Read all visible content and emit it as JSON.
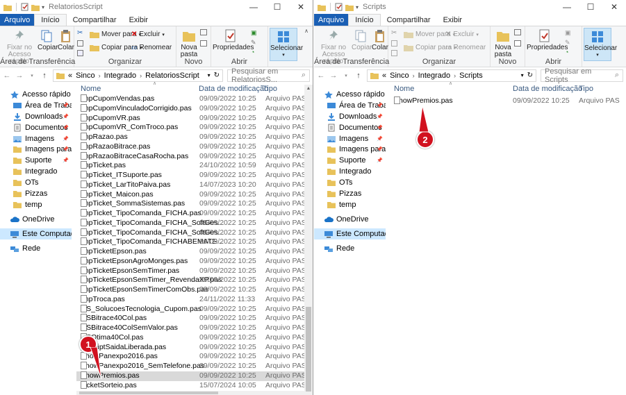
{
  "left": {
    "title": "RelatoriosScript",
    "tabs": [
      "Arquivo",
      "Início",
      "Compartilhar",
      "Exibir"
    ],
    "ribbon": {
      "pin": "Fixar no Acesso rápido",
      "copy": "Copiar",
      "paste": "Colar",
      "move": "Mover para",
      "copyto": "Copiar para",
      "delete": "Excluir",
      "rename": "Renomear",
      "newfolder": "Nova pasta",
      "properties": "Propriedades",
      "select": "Selecionar",
      "g_clip": "Área de Transferência",
      "g_org": "Organizar",
      "g_new": "Novo",
      "g_open": "Abrir"
    },
    "path": [
      "Sinco",
      "Integrado",
      "RelatoriosScript"
    ],
    "path_prefix": "«",
    "search_placeholder": "Pesquisar em RelatoriosS...",
    "columns": {
      "name": "Nome",
      "date": "Data de modificação",
      "type": "Tipo"
    },
    "files": [
      {
        "name": "ImpCupomVendas.pas",
        "date": "09/09/2022 10:25",
        "type": "Arquivo PAS"
      },
      {
        "name": "ImpCupomVinculadoCorrigido.pas",
        "date": "09/09/2022 10:25",
        "type": "Arquivo PAS"
      },
      {
        "name": "ImpCupomVR.pas",
        "date": "09/09/2022 10:25",
        "type": "Arquivo PAS"
      },
      {
        "name": "ImpCupomVR_ComTroco.pas",
        "date": "09/09/2022 10:25",
        "type": "Arquivo PAS"
      },
      {
        "name": "ImpRazao.pas",
        "date": "09/09/2022 10:25",
        "type": "Arquivo PAS"
      },
      {
        "name": "ImpRazaoBitrace.pas",
        "date": "09/09/2022 10:25",
        "type": "Arquivo PAS"
      },
      {
        "name": "ImpRazaoBitraceCasaRocha.pas",
        "date": "09/09/2022 10:25",
        "type": "Arquivo PAS"
      },
      {
        "name": "ImpTicket.pas",
        "date": "24/10/2022 10:59",
        "type": "Arquivo PAS"
      },
      {
        "name": "ImpTicket_ITSuporte.pas",
        "date": "09/09/2022 10:25",
        "type": "Arquivo PAS"
      },
      {
        "name": "ImpTicket_LarTitoPaiva.pas",
        "date": "14/07/2023 10:20",
        "type": "Arquivo PAS"
      },
      {
        "name": "ImpTicket_Maicon.pas",
        "date": "09/09/2022 10:25",
        "type": "Arquivo PAS"
      },
      {
        "name": "ImpTicket_SommaSistemas.pas",
        "date": "09/09/2022 10:25",
        "type": "Arquivo PAS"
      },
      {
        "name": "ImpTicket_TipoComanda_FICHA.pas",
        "date": "09/09/2022 10:25",
        "type": "Arquivo PAS"
      },
      {
        "name": "ImpTicket_TipoComanda_FICHA_SoftGes...",
        "date": "09/09/2022 10:25",
        "type": "Arquivo PAS"
      },
      {
        "name": "ImpTicket_TipoComanda_FICHA_SoftGes...",
        "date": "09/09/2022 10:25",
        "type": "Arquivo PAS"
      },
      {
        "name": "ImpTicket_TipoComanda_FICHABEMATE...",
        "date": "09/09/2022 10:25",
        "type": "Arquivo PAS"
      },
      {
        "name": "ImpTicketEpson.pas",
        "date": "09/09/2022 10:25",
        "type": "Arquivo PAS"
      },
      {
        "name": "ImpTicketEpsonAgroMonges.pas",
        "date": "09/09/2022 10:25",
        "type": "Arquivo PAS"
      },
      {
        "name": "ImpTicketEpsonSemTimer.pas",
        "date": "09/09/2022 10:25",
        "type": "Arquivo PAS"
      },
      {
        "name": "ImpTicketEpsonSemTimer_RevendaXP.pas",
        "date": "09/09/2022 10:25",
        "type": "Arquivo PAS"
      },
      {
        "name": "ImpTicketEpsonSemTimerComObs.pas",
        "date": "09/09/2022 10:25",
        "type": "Arquivo PAS"
      },
      {
        "name": "ImpTroca.pas",
        "date": "24/11/2022 11:33",
        "type": "Arquivo PAS"
      },
      {
        "name": "OS_SolucoesTecnologia_Cupom.pas",
        "date": "09/09/2022 10:25",
        "type": "Arquivo PAS"
      },
      {
        "name": "OSBitrace40Col.pas",
        "date": "09/09/2022 10:25",
        "type": "Arquivo PAS"
      },
      {
        "name": "OSBitrace40ColSemValor.pas",
        "date": "09/09/2022 10:25",
        "type": "Arquivo PAS"
      },
      {
        "name": "OSOtima40Col.pas",
        "date": "09/09/2022 10:25",
        "type": "Arquivo PAS"
      },
      {
        "name": "ReceiptSaidaLiberada.pas",
        "date": "09/09/2022 10:25",
        "type": "Arquivo PAS"
      },
      {
        "name": "ShowPanexpo2016.pas",
        "date": "09/09/2022 10:25",
        "type": "Arquivo PAS"
      },
      {
        "name": "ShowPanexpo2016_SemTelefone.pas",
        "date": "09/09/2022 10:25",
        "type": "Arquivo PAS"
      },
      {
        "name": "ShowPremios.pas",
        "date": "09/09/2022 10:25",
        "type": "Arquivo PAS",
        "selected": true
      },
      {
        "name": "TicketSorteio.pas",
        "date": "15/07/2024 10:05",
        "type": "Arquivo PAS"
      }
    ],
    "badge": "1"
  },
  "right": {
    "title": "Scripts",
    "tabs": [
      "Arquivo",
      "Início",
      "Compartilhar",
      "Exibir"
    ],
    "ribbon": {
      "pin": "Fixar no Acesso rápido",
      "copy": "Copiar",
      "paste": "Colar",
      "move": "Mover para",
      "copyto": "Copiar para",
      "delete": "Excluir",
      "rename": "Renomear",
      "newfolder": "Nova pasta",
      "properties": "Propriedades",
      "select": "Selecionar",
      "g_clip": "Área de Transferência",
      "g_org": "Organizar",
      "g_new": "Novo",
      "g_open": "Abrir"
    },
    "path": [
      "Sinco",
      "Integrado",
      "Scripts"
    ],
    "path_prefix": "«",
    "search_placeholder": "Pesquisar em Scripts",
    "columns": {
      "name": "Nome",
      "date": "Data de modificação",
      "type": "Tipo"
    },
    "files": [
      {
        "name": "ShowPremios.pas",
        "date": "09/09/2022 10:25",
        "type": "Arquivo PAS"
      }
    ],
    "badge": "2"
  },
  "navpane": [
    {
      "label": "Acesso rápido",
      "icon": "star-icon",
      "pinned": false,
      "gap": 0
    },
    {
      "label": "Área de Trabalho",
      "icon": "desktop-icon",
      "pinned": true,
      "gap": 0
    },
    {
      "label": "Downloads",
      "icon": "download-icon",
      "pinned": true,
      "gap": 0
    },
    {
      "label": "Documentos",
      "icon": "documents-icon",
      "pinned": true,
      "gap": 0
    },
    {
      "label": "Imagens",
      "icon": "pictures-icon",
      "pinned": true,
      "gap": 0
    },
    {
      "label": "Imagens para Inp",
      "icon": "folder-icon",
      "pinned": true,
      "gap": 0
    },
    {
      "label": "Suporte",
      "icon": "folder-icon",
      "pinned": true,
      "gap": 0
    },
    {
      "label": "Integrado",
      "icon": "folder-icon",
      "pinned": false,
      "gap": 0
    },
    {
      "label": "OTs",
      "icon": "folder-icon",
      "pinned": false,
      "gap": 0
    },
    {
      "label": "Pizzas",
      "icon": "folder-icon",
      "pinned": false,
      "gap": 0
    },
    {
      "label": "temp",
      "icon": "folder-icon",
      "pinned": false,
      "gap": 0
    },
    {
      "label": "OneDrive",
      "icon": "cloud-icon",
      "pinned": false,
      "gap": 1
    },
    {
      "label": "Este Computador",
      "icon": "computer-icon",
      "pinned": false,
      "gap": 1,
      "selected": true
    },
    {
      "label": "Rede",
      "icon": "network-icon",
      "pinned": false,
      "gap": 1
    }
  ],
  "colors": {
    "accent": "#1a5fb4",
    "selection": "#cce8ff",
    "badge": "#d1111f",
    "folder": "#e8c25a"
  }
}
